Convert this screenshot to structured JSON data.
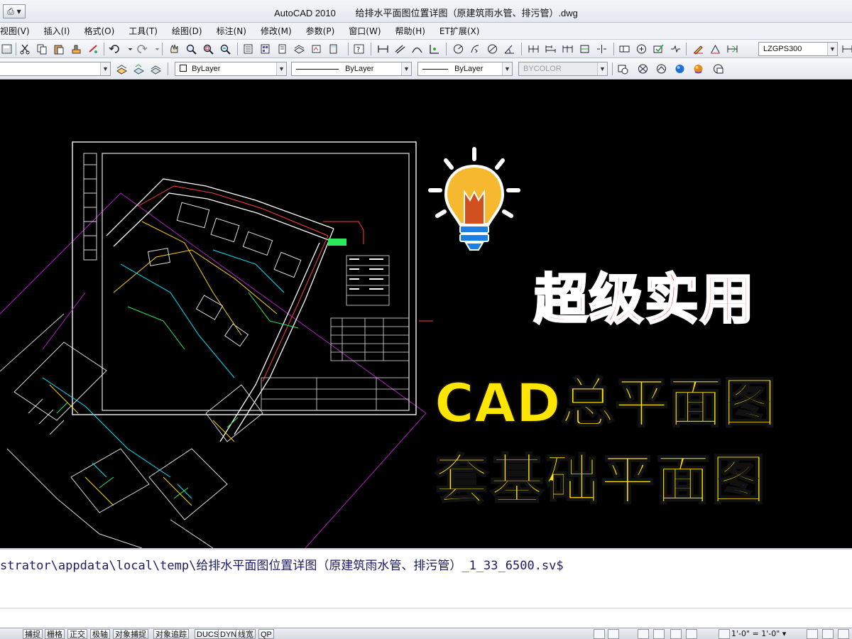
{
  "window": {
    "app_name": "AutoCAD 2010",
    "document_title": "给排水平面图位置详图（原建筑雨水管、排污管）.dwg",
    "quick_access": "⎙ ▾"
  },
  "menu": [
    "视图(V)",
    "插入(I)",
    "格式(O)",
    "工具(T)",
    "绘图(D)",
    "标注(N)",
    "修改(M)",
    "参数(P)",
    "窗口(W)",
    "帮助(H)",
    "ET扩展(X)"
  ],
  "toolbar": {
    "dimstyle_combo": "LZGPS300",
    "color_combo": "ByLayer",
    "linetype_combo": "ByLayer",
    "lineweight_combo": "ByLayer",
    "plotstyle_combo": "BYCOLOR"
  },
  "overlay": {
    "headline_red": "超级实用",
    "headline_yellow_1": "CAD总平面图",
    "headline_yellow_2": "套基础平面图",
    "colors": {
      "red": "#e8151b",
      "yellow": "#ffe500",
      "bulb": "#f5b82e"
    }
  },
  "command_line": {
    "history": "strator\\appdata\\local\\temp\\给排水平面图位置详图（原建筑雨水管、排污管）_1_33_6500.sv$",
    "input": ""
  },
  "status_bar": {
    "toggles": [
      "捕捉",
      "栅格",
      "正交",
      "极轴",
      "对象捕捉",
      "对象追踪",
      "DUCS",
      "DYN",
      "线宽",
      "QP"
    ],
    "annotation_scale": "1'-0\" = 1'-0\" ▾"
  }
}
